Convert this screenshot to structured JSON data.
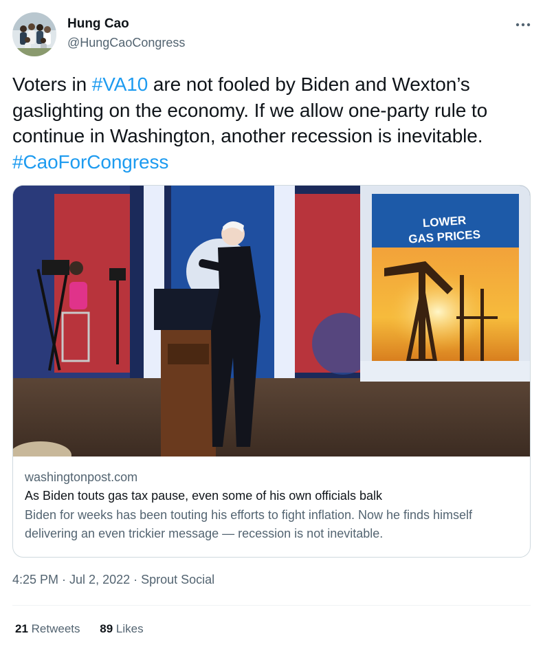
{
  "author": {
    "name": "Hung Cao",
    "handle": "@HungCaoCongress",
    "more_icon": "more-horizontal-icon"
  },
  "tweet": {
    "text_part1": "Voters in ",
    "hashtag1": "#VA10",
    "text_part2": " are not fooled by Biden and Wexton’s gaslighting on the economy. If we allow one-party rule to continue in Washington, another recession is inevitable. ",
    "hashtag2": "#CaoForCongress"
  },
  "card": {
    "image_sign": "LOWER GAS PRICES",
    "image_sign_line1": "LOWER",
    "image_sign_line2": "GAS PRICES",
    "domain": "washingtonpost.com",
    "title": "As Biden touts gas tax pause, even some of his own officials balk",
    "description": "Biden for weeks has been touting his efforts to fight inflation. Now he finds himself delivering an even trickier message — recession is not inevitable."
  },
  "meta": {
    "time": "4:25 PM",
    "sep1": " · ",
    "date": "Jul 2, 2022",
    "sep2": " · ",
    "source": "Sprout Social"
  },
  "stats": {
    "retweets_count": "21",
    "retweets_label": "Retweets",
    "likes_count": "89",
    "likes_label": "Likes"
  },
  "colors": {
    "link": "#1d9bf0",
    "secondary_text": "#536471",
    "border": "#cfd9de"
  }
}
